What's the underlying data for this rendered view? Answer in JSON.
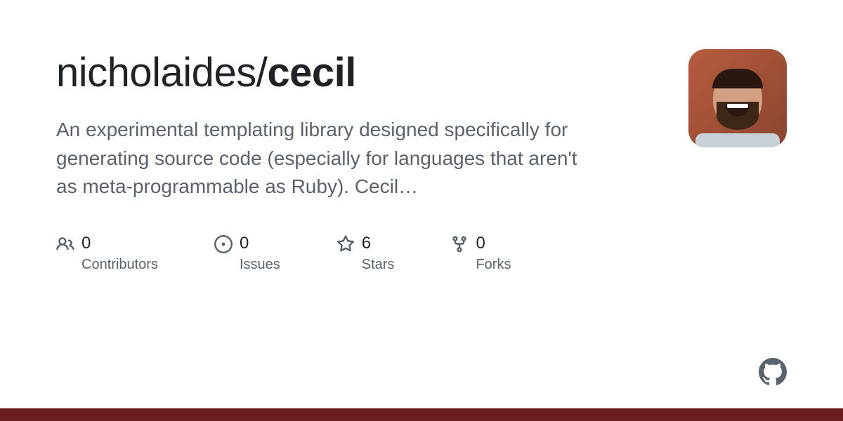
{
  "repo": {
    "owner": "nicholaides",
    "name": "cecil"
  },
  "description": "An experimental templating library designed specifically for generating source code (especially for languages that aren't as meta-programmable as Ruby). Cecil…",
  "stats": {
    "contributors": {
      "count": "0",
      "label": "Contributors"
    },
    "issues": {
      "count": "0",
      "label": "Issues"
    },
    "stars": {
      "count": "6",
      "label": "Stars"
    },
    "forks": {
      "count": "0",
      "label": "Forks"
    }
  }
}
